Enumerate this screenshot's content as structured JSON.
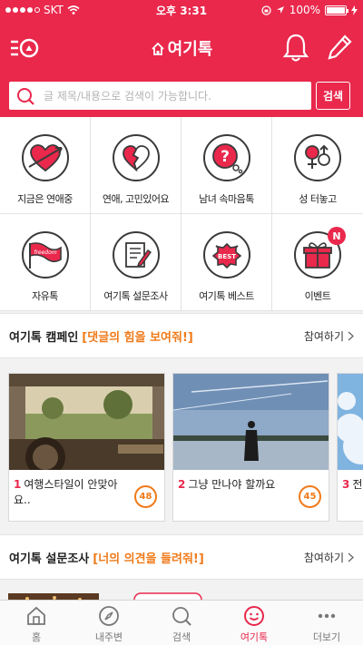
{
  "status_bar": {
    "carrier": "SKT",
    "time": "오후 3:31",
    "battery": "100%",
    "battery_level": 1.0
  },
  "header": {
    "title": "여기톡"
  },
  "search": {
    "placeholder": "글 제목/내용으로 검색이 가능합니다.",
    "button_label": "검색"
  },
  "categories": [
    {
      "label": "지금은 연애중",
      "icon": "arrow-heart-icon"
    },
    {
      "label": "연애, 고민있어요",
      "icon": "broken-heart-icon"
    },
    {
      "label": "남녀 속마음톡",
      "icon": "question-bubble-icon"
    },
    {
      "label": "성 터놓고",
      "icon": "gender-symbols-icon"
    },
    {
      "label": "자유톡",
      "icon": "freedom-flag-icon"
    },
    {
      "label": "여기톡 설문조사",
      "icon": "survey-clipboard-icon"
    },
    {
      "label": "여기톡 베스트",
      "icon": "best-badge-icon"
    },
    {
      "label": "이벤트",
      "icon": "gift-box-icon",
      "badge": "N"
    }
  ],
  "campaign": {
    "title": "여기톡 캠페인",
    "slogan": "[댓글의 힘을 보여줘!]",
    "join_label": "참여하기",
    "cards": [
      {
        "rank": "1",
        "title": "여행스타일이 안맞아요..",
        "comments": "48"
      },
      {
        "rank": "2",
        "title": "그냥 만나야 할까요",
        "comments": "45"
      },
      {
        "rank": "3",
        "title": "전 곳",
        "comments": ""
      }
    ]
  },
  "survey": {
    "title": "여기톡 설문조사",
    "slogan": "[너의 의견을 들려줘!]",
    "join_label": "참여하기"
  },
  "tabs": [
    {
      "label": "홈",
      "icon": "home-icon",
      "active": false
    },
    {
      "label": "내주변",
      "icon": "compass-icon",
      "active": false
    },
    {
      "label": "검색",
      "icon": "search-icon",
      "active": false
    },
    {
      "label": "여기톡",
      "icon": "smile-talk-icon",
      "active": true
    },
    {
      "label": "더보기",
      "icon": "more-dots-icon",
      "active": false
    }
  ],
  "colors": {
    "brand": "#e9284c",
    "accent": "#f07a1a"
  }
}
